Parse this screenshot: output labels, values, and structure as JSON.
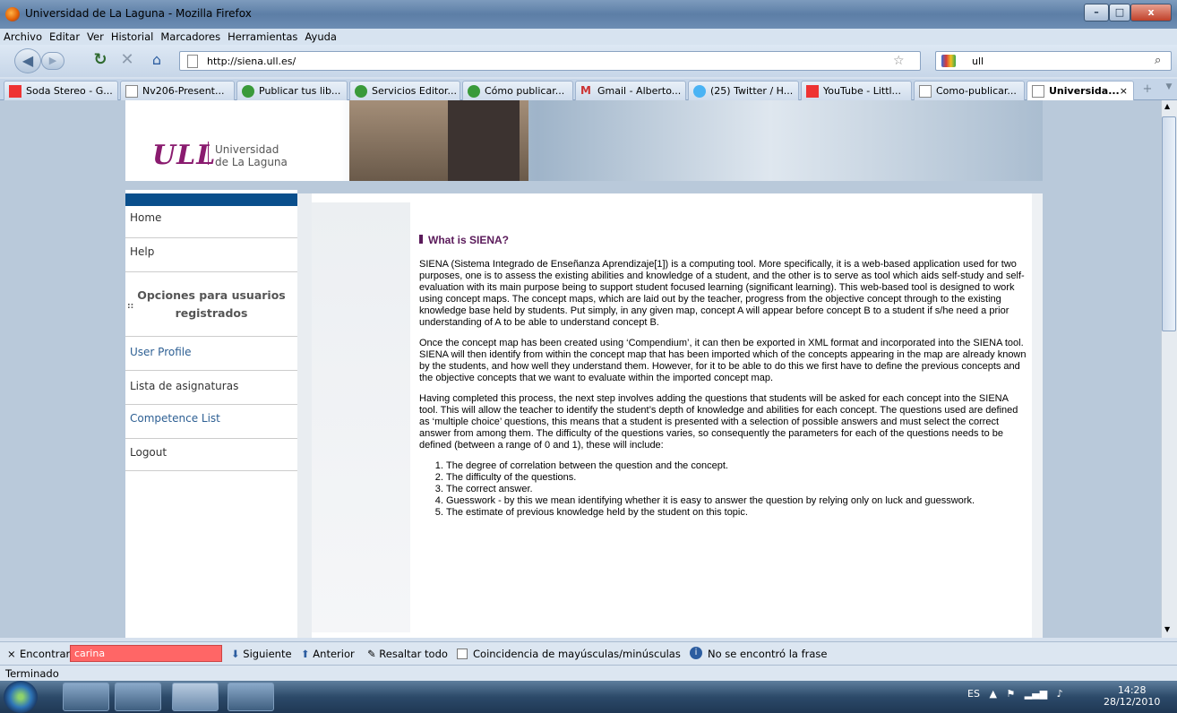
{
  "window": {
    "title": "Universidad de La Laguna - Mozilla Firefox",
    "btn_min": "–",
    "btn_max": "□",
    "btn_close": "x"
  },
  "menu": [
    "Archivo",
    "Editar",
    "Ver",
    "Historial",
    "Marcadores",
    "Herramientas",
    "Ayuda"
  ],
  "nav": {
    "url": "http://siena.ull.es/",
    "search_value": "ull"
  },
  "tabs": [
    {
      "label": "Soda Stereo - G...",
      "icon": "youtube-icon"
    },
    {
      "label": "Nv206-Present...",
      "icon": "page-icon"
    },
    {
      "label": "Publicar tus lib...",
      "icon": "green-icon"
    },
    {
      "label": "Servicios Editor...",
      "icon": "green-icon"
    },
    {
      "label": "Cómo publicar...",
      "icon": "green-icon"
    },
    {
      "label": "Gmail - Alberto...",
      "icon": "gmail-icon"
    },
    {
      "label": "(25) Twitter / H...",
      "icon": "twitter-icon"
    },
    {
      "label": "YouTube - Littl...",
      "icon": "youtube-icon"
    },
    {
      "label": "Como-publicar...",
      "icon": "page-icon"
    },
    {
      "label": "Universida...",
      "icon": "page-icon",
      "active": true
    }
  ],
  "logo": {
    "mark": "ULL",
    "line1": "Universidad",
    "line2": "de La Laguna"
  },
  "sidebar": {
    "home": "Home",
    "help": "Help",
    "options_header": "Opciones para usuarios registrados",
    "marker": "::",
    "user_profile": "User Profile",
    "subjects": "Lista de asignaturas",
    "competence": "Competence List",
    "logout": "Logout"
  },
  "article": {
    "heading": "What is SIENA?",
    "p1": "SIENA (Sistema Integrado de Enseñanza Aprendizaje[1]) is a computing tool. More specifically, it is a web-based application used for two purposes, one is to assess the existing abilities and knowledge of a student, and the other is to serve as tool which aids self-study and self-evaluation with its main purpose being to support student focused learning (significant learning). This web-based tool is designed to work using concept maps. The concept maps, which are laid out by the teacher, progress from the objective concept through to the existing knowledge base held by students. Put simply, in any given map, concept A will appear before concept B to a student if s/he need a prior understanding of A to be able to understand concept B.",
    "p2": "Once the concept map has been created using ‘Compendium’, it can then be exported in XML format and incorporated into the SIENA tool. SIENA will then identify from within the concept map that has been imported which of the concepts appearing in the map are already known by the students, and how well they understand them. However, for it to be able to do this we first have to define the previous concepts and the objective concepts that we want to evaluate within the imported concept map.",
    "p3": "Having completed this process, the next step involves adding the questions that students will be asked for each concept into the SIENA tool. This will allow the teacher to identify the student’s depth of knowledge and abilities for each concept. The questions used are defined as ‘multiple choice’ questions, this means that a student is presented with a selection of possible answers and must select the correct answer from among them. The difficulty of the questions varies, so consequently the parameters for each of the questions needs to be defined (between a range of 0 and 1), these will include:",
    "list": [
      "The degree of correlation between the question and the concept.",
      "The difficulty of the questions.",
      "The correct answer.",
      "Guesswork - by this we mean identifying whether it is easy to answer the question by relying only on luck and guesswork.",
      "The estimate of previous knowledge held by the student on this topic."
    ]
  },
  "findbar": {
    "label": "Encontrar:",
    "value": "carina",
    "next": "Siguiente",
    "prev": "Anterior",
    "highlight": "Resaltar todo",
    "match_case": "Coincidencia de mayúsculas/minúsculas",
    "not_found": "No se encontró la frase"
  },
  "status": "Terminado",
  "taskbar": {
    "lang": "ES",
    "time": "14:28",
    "date": "28/12/2010"
  },
  "colors": {
    "accent": "#8a1b6f",
    "navbar_blue": "#0a4f8c",
    "find_error": "#ff6666"
  }
}
